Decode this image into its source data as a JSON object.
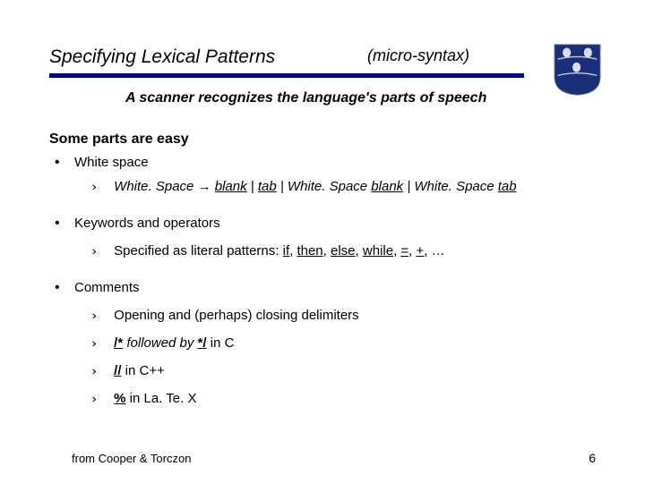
{
  "header": {
    "title": "Specifying Lexical Patterns",
    "subtitle": "(micro-syntax)"
  },
  "tagline": "A scanner recognizes the language's parts of speech",
  "intro": "Some parts are easy",
  "bullets": {
    "ws": {
      "label": "White space",
      "grammar_prefix": "White. Space ",
      "arrow": "→",
      "g_blank": "blank",
      "g_bar1": " | ",
      "g_tab": "tab",
      "g_bar2": " | White. Space ",
      "g_blank2": "blank",
      "g_bar3": " | White. Space ",
      "g_tab2": "tab"
    },
    "kw": {
      "label": "Keywords and operators",
      "sub_prefix": "Specified as literal patterns:  ",
      "if": "if",
      "c1": ", ",
      "then": "then",
      "c2": ", ",
      "else": "else",
      "c3": ", ",
      "while": "while",
      "c4": ", ",
      "eq": "=",
      "c5": ", ",
      "plus": "+",
      "c6": ", …"
    },
    "cm": {
      "label": "Comments",
      "l1_a": "Opening and ",
      "l1_b": "(perhaps)",
      "l1_c": " closing delimiters",
      "l2_a": "/*",
      "l2_b": "  followed by  ",
      "l2_c": "*/",
      "l2_d": "  in C",
      "l3_a": "//",
      "l3_b": "  in C++",
      "l4_a": "%",
      "l4_b": "  in La. Te. X"
    }
  },
  "footer": {
    "left": "from Cooper & Torczon",
    "right": "6"
  }
}
